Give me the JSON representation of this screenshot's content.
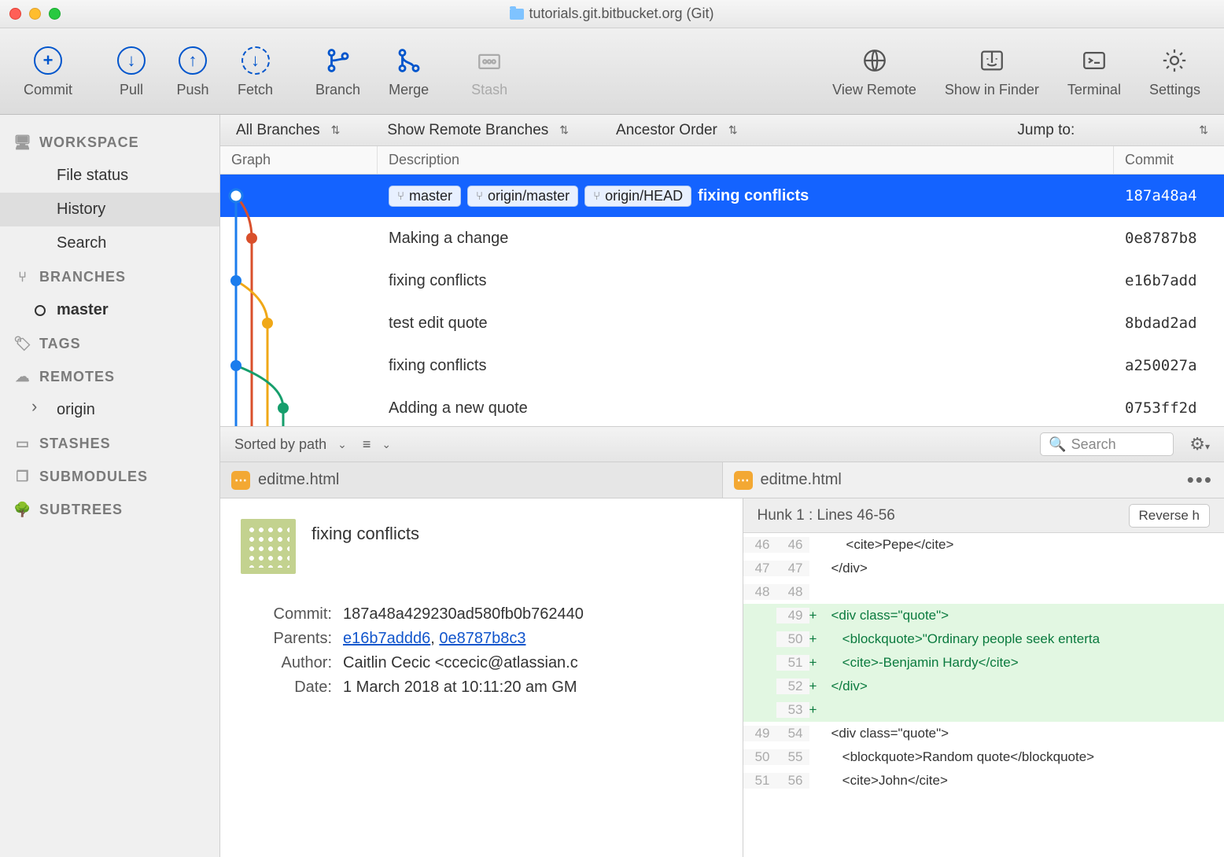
{
  "window": {
    "title": "tutorials.git.bitbucket.org (Git)"
  },
  "toolbar": {
    "commit": "Commit",
    "pull": "Pull",
    "push": "Push",
    "fetch": "Fetch",
    "branch": "Branch",
    "merge": "Merge",
    "stash": "Stash",
    "view_remote": "View Remote",
    "show_in_finder": "Show in Finder",
    "terminal": "Terminal",
    "settings": "Settings"
  },
  "sidebar": {
    "workspace_label": "WORKSPACE",
    "file_status": "File status",
    "history": "History",
    "search": "Search",
    "branches_label": "BRANCHES",
    "master": "master",
    "tags_label": "TAGS",
    "remotes_label": "REMOTES",
    "origin": "origin",
    "stashes_label": "STASHES",
    "submodules_label": "SUBMODULES",
    "subtrees_label": "SUBTREES"
  },
  "filters": {
    "all_branches": "All Branches",
    "show_remote": "Show Remote Branches",
    "ancestor": "Ancestor Order",
    "jump_to": "Jump to:"
  },
  "columns": {
    "graph": "Graph",
    "description": "Description",
    "commit": "Commit"
  },
  "commits": [
    {
      "tags": [
        "master",
        "origin/master",
        "origin/HEAD"
      ],
      "msg": "fixing conflicts",
      "sha": "187a48a4"
    },
    {
      "tags": [],
      "msg": "Making a change",
      "sha": "0e8787b8"
    },
    {
      "tags": [],
      "msg": "fixing conflicts",
      "sha": "e16b7add"
    },
    {
      "tags": [],
      "msg": "test edit quote",
      "sha": "8bdad2ad"
    },
    {
      "tags": [],
      "msg": "fixing conflicts",
      "sha": "a250027a"
    },
    {
      "tags": [],
      "msg": "Adding a new quote",
      "sha": "0753ff2d"
    }
  ],
  "midbar": {
    "sort": "Sorted by path",
    "search_placeholder": "Search"
  },
  "files": {
    "left": "editme.html",
    "right": "editme.html"
  },
  "detail": {
    "title": "fixing conflicts",
    "commit_label": "Commit:",
    "commit_val": "187a48a429230ad580fb0b762440",
    "parents_label": "Parents:",
    "parent1": "e16b7addd6",
    "parent2": "0e8787b8c3",
    "author_label": "Author:",
    "author_val": "Caitlin Cecic <ccecic@atlassian.c",
    "date_label": "Date:",
    "date_val": "1 March 2018 at 10:11:20 am GM"
  },
  "hunk": {
    "label": "Hunk 1 : Lines 46-56",
    "reverse": "Reverse h"
  },
  "diff": [
    {
      "l": "46",
      "r": "46",
      "t": "ctx",
      "c": "    <cite>Pepe</cite>"
    },
    {
      "l": "47",
      "r": "47",
      "t": "ctx",
      "c": "</div>"
    },
    {
      "l": "48",
      "r": "48",
      "t": "ctx",
      "c": ""
    },
    {
      "l": "",
      "r": "49",
      "t": "add",
      "c": "<div class=\"quote\">"
    },
    {
      "l": "",
      "r": "50",
      "t": "add",
      "c": "   <blockquote>\"Ordinary people seek enterta"
    },
    {
      "l": "",
      "r": "51",
      "t": "add",
      "c": "   <cite>-Benjamin Hardy</cite>"
    },
    {
      "l": "",
      "r": "52",
      "t": "add",
      "c": "</div>"
    },
    {
      "l": "",
      "r": "53",
      "t": "add",
      "c": ""
    },
    {
      "l": "49",
      "r": "54",
      "t": "ctx",
      "c": "<div class=\"quote\">"
    },
    {
      "l": "50",
      "r": "55",
      "t": "ctx",
      "c": "   <blockquote>Random quote</blockquote>"
    },
    {
      "l": "51",
      "r": "56",
      "t": "ctx",
      "c": "   <cite>John</cite>"
    }
  ]
}
